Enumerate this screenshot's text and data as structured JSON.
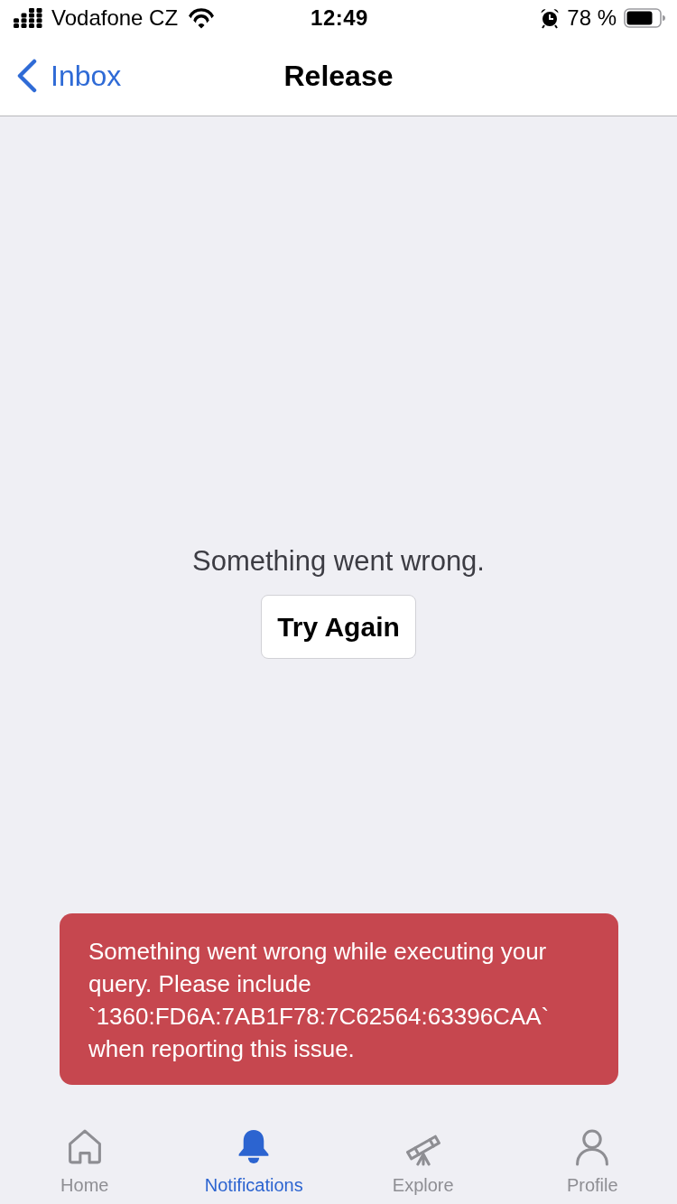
{
  "status_bar": {
    "carrier": "Vodafone CZ",
    "time": "12:49",
    "battery": "78 %"
  },
  "nav_bar": {
    "back": "Inbox",
    "title": "Release"
  },
  "content": {
    "message": "Something went wrong.",
    "button": "Try Again"
  },
  "toast": {
    "message": "Something went wrong while executing your query. Please include `1360:FD6A:7AB1F78:7C62564:63396CAA` when reporting this issue."
  },
  "tab_bar": [
    {
      "kind": "home",
      "label": "Home",
      "selected": false
    },
    {
      "kind": "notifications",
      "label": "Notifications",
      "selected": true
    },
    {
      "kind": "explore",
      "label": "Explore",
      "selected": false
    },
    {
      "kind": "profile",
      "label": "Profile",
      "selected": false
    }
  ]
}
